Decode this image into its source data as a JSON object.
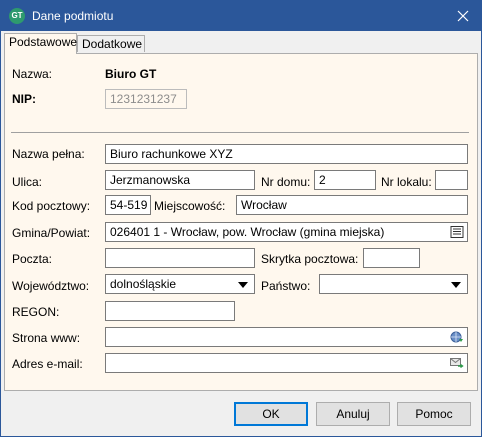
{
  "window": {
    "title": "Dane podmiotu",
    "app_icon_text": "GT"
  },
  "tabs": [
    {
      "label": "Podstawowe"
    },
    {
      "label": "Dodatkowe"
    }
  ],
  "form": {
    "nazwa_label": "Nazwa:",
    "nazwa_value": "Biuro GT",
    "nip_label": "NIP:",
    "nip_value": "1231231237",
    "nazwa_pelna_label": "Nazwa pełna:",
    "nazwa_pelna_value": "Biuro rachunkowe XYZ",
    "ulica_label": "Ulica:",
    "ulica_value": "Jerzmanowska",
    "nr_domu_label": "Nr domu:",
    "nr_domu_value": "2",
    "nr_lokalu_label": "Nr lokalu:",
    "nr_lokalu_value": "",
    "kod_label": "Kod pocztowy:",
    "kod_value": "54-519",
    "miejscowosc_label": "Miejscowość:",
    "miejscowosc_value": "Wrocław",
    "gmina_label": "Gmina/Powiat:",
    "gmina_value": "026401 1 - Wrocław, pow. Wrocław (gmina miejska)",
    "poczta_label": "Poczta:",
    "poczta_value": "",
    "skrytka_label": "Skrytka pocztowa:",
    "skrytka_value": "",
    "wojewodztwo_label": "Województwo:",
    "wojewodztwo_value": "dolnośląskie",
    "panstwo_label": "Państwo:",
    "panstwo_value": "",
    "regon_label": "REGON:",
    "regon_value": "",
    "www_label": "Strona www:",
    "www_value": "",
    "email_label": "Adres e-mail:",
    "email_value": ""
  },
  "buttons": {
    "ok": "OK",
    "cancel": "Anuluj",
    "help": "Pomoc"
  },
  "colors": {
    "titlebar": "#2b579a",
    "panel": "#fff8ee",
    "accent": "#0078d7"
  }
}
